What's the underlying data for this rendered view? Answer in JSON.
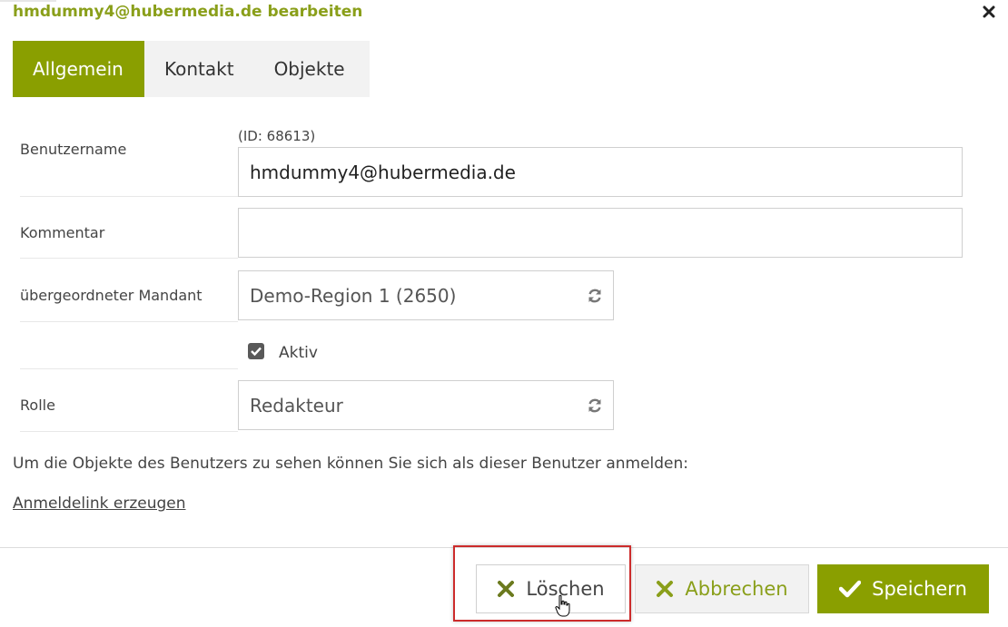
{
  "dialog": {
    "title": "hmdummy4@hubermedia.de bearbeiten"
  },
  "tabs": [
    {
      "label": "Allgemein",
      "active": true
    },
    {
      "label": "Kontakt",
      "active": false
    },
    {
      "label": "Objekte",
      "active": false
    }
  ],
  "form": {
    "username": {
      "label": "Benutzername",
      "id_note": "(ID: 68613)",
      "value": "hmdummy4@hubermedia.de"
    },
    "comment": {
      "label": "Kommentar",
      "value": ""
    },
    "parent_client": {
      "label": "übergeordneter Mandant",
      "value": "Demo-Region 1 (2650)"
    },
    "active": {
      "label": "Aktiv",
      "checked": true
    },
    "role": {
      "label": "Rolle",
      "value": "Redakteur"
    }
  },
  "info_text": "Um die Objekte des Benutzers zu sehen können Sie sich als dieser Benutzer anmelden:",
  "login_link": "Anmeldelink erzeugen",
  "buttons": {
    "delete": "Löschen",
    "cancel": "Abbrechen",
    "save": "Speichern"
  },
  "colors": {
    "accent": "#8a9f00",
    "highlight": "#cc2b2b"
  }
}
